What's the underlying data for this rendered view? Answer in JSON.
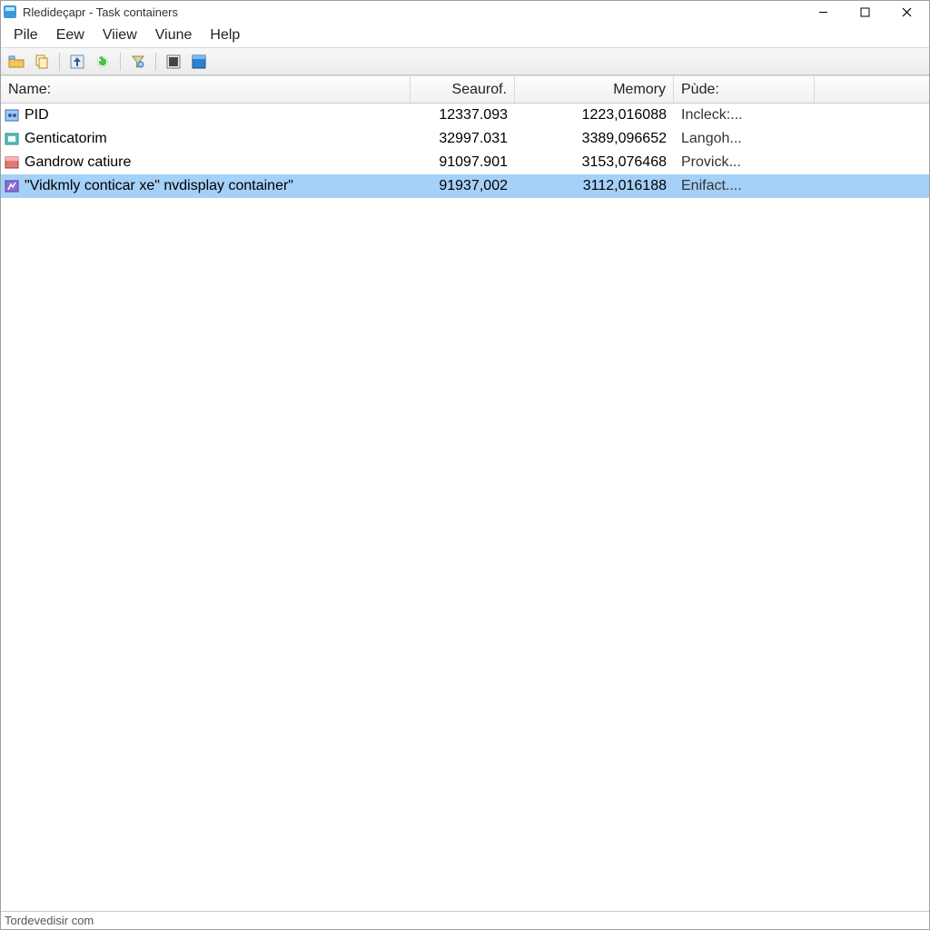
{
  "window": {
    "title": "Rledideçapr - Task containers"
  },
  "menu": {
    "items": [
      "Pile",
      "Eew",
      "Viiew",
      "Viune",
      "Help"
    ]
  },
  "toolbar": {
    "icons": [
      "open-folder",
      "copy",
      "up-arrow",
      "refresh",
      "filter",
      "properties",
      "window"
    ]
  },
  "columns": {
    "name": "Name:",
    "search": "Seaurof.",
    "memory": "Memory",
    "pide": "Pùde:"
  },
  "rows": [
    {
      "name": "PID",
      "search": "12337.093",
      "memory": "1223,016088",
      "pide": "Incleck:...",
      "icon": "process-blue",
      "selected": false
    },
    {
      "name": "Genticatorim",
      "search": "32997.031",
      "memory": "3389,096652",
      "pide": "Langoh...",
      "icon": "process-teal",
      "selected": false
    },
    {
      "name": "Gandrow catiure",
      "search": "91097.901",
      "memory": "3153,076468",
      "pide": "Provick...",
      "icon": "process-red",
      "selected": false
    },
    {
      "name": "\"Vidkmly conticar xe\" nvdisplay container\"",
      "search": "91937,002",
      "memory": "3112,016188",
      "pide": "Enifact....",
      "icon": "process-purple",
      "selected": true
    }
  ],
  "statusbar": {
    "text": "Tordevedisir com"
  }
}
